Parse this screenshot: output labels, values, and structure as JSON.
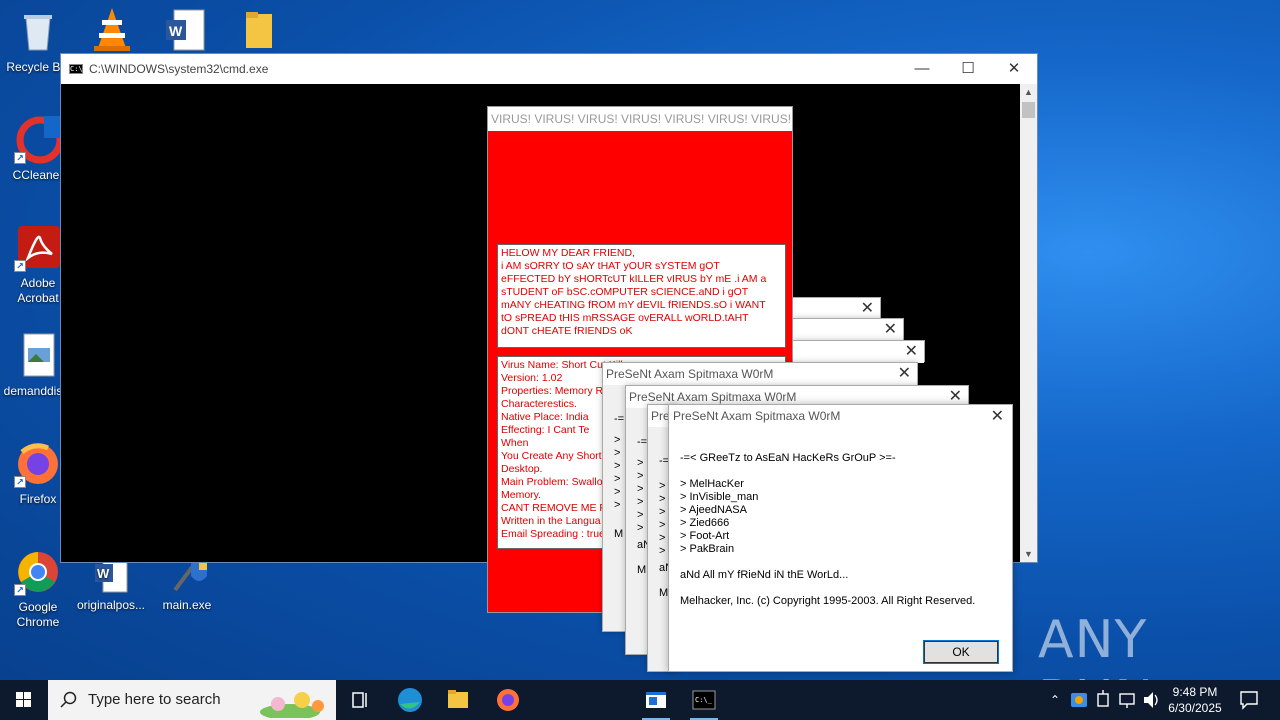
{
  "desktop": {
    "icons": [
      {
        "label": "Recycle Bin"
      },
      {
        "label": "CCleaner"
      },
      {
        "label": "Adobe Acrobat"
      },
      {
        "label": "demanddis..."
      },
      {
        "label": "Firefox"
      },
      {
        "label": "Google Chrome"
      },
      {
        "label": "originalpos..."
      },
      {
        "label": "main.exe"
      }
    ],
    "watermark": "ANY RUN"
  },
  "cmd_window": {
    "title": "C:\\WINDOWS\\system32\\cmd.exe"
  },
  "virus_window": {
    "title": "VIRUS! VIRUS! VIRUS! VIRUS! VIRUS! VIRUS! VIRUS!",
    "message": [
      "HELOW MY DEAR FRIEND,",
      "i AM sORRY tO sAY tHAT yOUR sYSTEM gOT",
      "eFFECTED bY sHORTcUT kILLER vIRUS bY mE .i AM a",
      "sTUDENT oF bSC.cOMPUTER sCIENCE.aND i gOT",
      "mANY cHEATING fROM mY dEVIL fRIENDS.sO i WANT",
      "tO sPREAD tHIS mRSSAGE ovERALL wORLD.tAHT",
      "dONT cHEATE fRIENDS oK"
    ],
    "info_lines": [
      "Virus Name:      Short Cut Kill",
      "Version:   1.02",
      "Properties:   Memory R",
      "Characterestics.",
      "Native Place:   India",
      "Effecting:      I Cant Te",
      "When",
      "You Create Any Short",
      "Desktop.",
      "Main Problem:   Swallo",
      "Memory.",
      "CANT REMOVE ME F",
      "Written in  the Langua",
      "Email Spreading : true"
    ]
  },
  "stacked_dialogs": {
    "titles": [
      "PreSeNt Axam Spitmaxa W0rM",
      "PreSeNt Axam Spitmaxa W0rM",
      "Pre"
    ],
    "fragment_aN": "aN",
    "fragment_M": "M",
    "fragment_eq": "-="
  },
  "front_dialog": {
    "title": "PreSeNt Axam Spitmaxa W0rM",
    "greeting": "-=< GReeTz to AsEaN HacKeRs GrOuP >=-",
    "members": [
      "> MelHacKer",
      "> InVisible_man",
      "> AjeedNASA",
      "> Zied666",
      "> Foot-Art",
      "> PakBrain"
    ],
    "closing": "aNd All mY fRieNd iN thE WorLd...",
    "copyright": "Melhacker, Inc. (c) Copyright 1995-2003. All Right Reserved.",
    "ok_label": "OK"
  },
  "taskbar": {
    "search_placeholder": "Type here to search",
    "time": "9:48 PM",
    "date": "6/30/2025"
  }
}
